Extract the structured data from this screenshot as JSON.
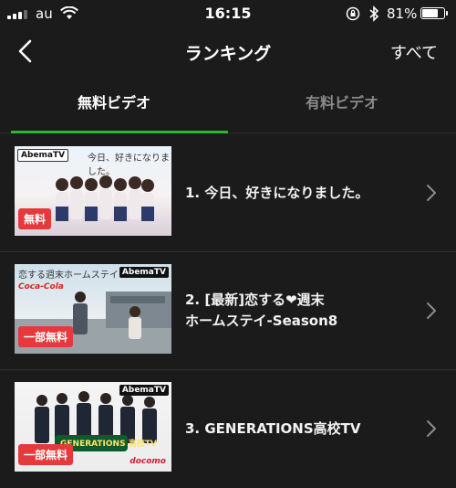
{
  "status_bar": {
    "carrier": "au",
    "time": "16:15",
    "battery_percent": "81%",
    "battery_level": 0.81
  },
  "nav": {
    "title": "ランキング",
    "all_label": "すべて"
  },
  "tabs": [
    {
      "label": "無料ビデオ",
      "active": true
    },
    {
      "label": "有料ビデオ",
      "active": false
    }
  ],
  "accent_color": "#2fb631",
  "badge_color": "#e5393b",
  "items": [
    {
      "title_line1": "1. 今日、好きになりました。",
      "title_line2": "",
      "badge": "無料",
      "abema_logo": "AbemaTV",
      "thumb_caption": "今日、好きになりました。"
    },
    {
      "title_line1": "2. [最新]恋する❤週末",
      "title_line2": "ホームステイ-Season8",
      "badge": "一部無料",
      "abema_logo": "AbemaTV",
      "thumb_caption": "恋する週末ホームステイ",
      "thumb_sponsor": "Coca-Cola"
    },
    {
      "title_line1": "3. GENERATIONS高校TV",
      "title_line2": "",
      "badge": "一部無料",
      "abema_logo": "AbemaTV",
      "thumb_caption": "GENERATIONS 高校TV",
      "thumb_sponsor": "docomo"
    }
  ]
}
